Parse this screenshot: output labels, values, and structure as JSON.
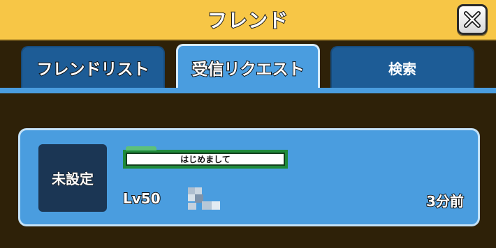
{
  "header": {
    "title": "フレンド",
    "close_icon": "close-icon"
  },
  "tabs": [
    {
      "label": "フレンドリスト",
      "active": false
    },
    {
      "label": "受信リクエスト",
      "active": true
    },
    {
      "label": "検索",
      "active": false
    }
  ],
  "request": {
    "avatar_label": "未設定",
    "comment": "はじめまして",
    "level": "Lv50",
    "time_ago": "3分前"
  },
  "colors": {
    "header": "#f7c646",
    "background": "#2e2108",
    "tab_active": "#4a9ddf",
    "tab_inactive": "#1d5c96",
    "avatar_bg": "#1b3654",
    "comment_border": "#1f8a3a"
  }
}
